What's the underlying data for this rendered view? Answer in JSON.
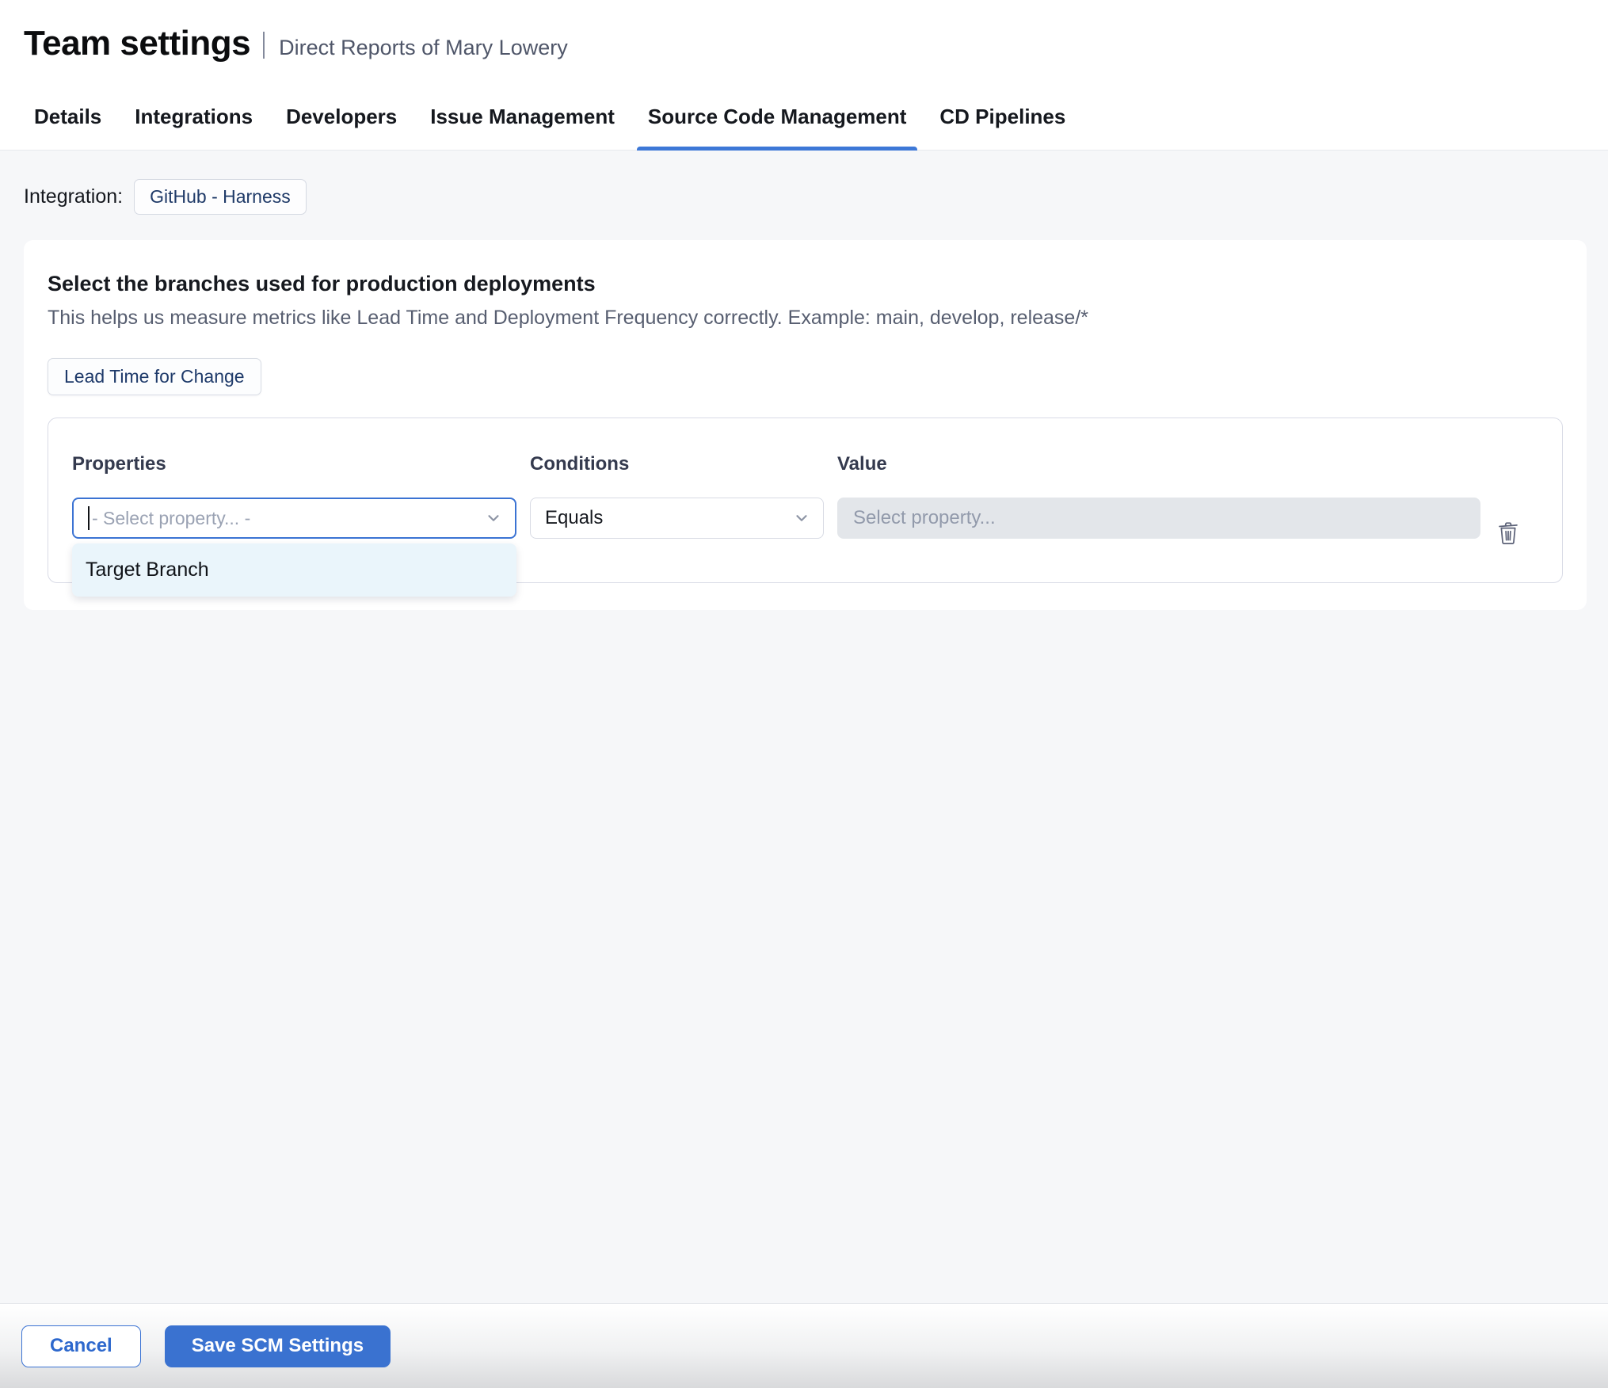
{
  "page": {
    "title": "Team settings",
    "subtitle": "Direct Reports of Mary Lowery"
  },
  "tabs": [
    {
      "label": "Details",
      "active": false
    },
    {
      "label": "Integrations",
      "active": false
    },
    {
      "label": "Developers",
      "active": false
    },
    {
      "label": "Issue Management",
      "active": false
    },
    {
      "label": "Source Code Management",
      "active": true
    },
    {
      "label": "CD Pipelines",
      "active": false
    }
  ],
  "integration": {
    "label": "Integration:",
    "chip": "GitHub - Harness"
  },
  "scm_card": {
    "heading": "Select the branches used for production deployments",
    "description": "This helps us measure metrics like Lead Time and Deployment Frequency correctly. Example: main, develop, release/*",
    "metric_tab": "Lead Time for Change",
    "filter": {
      "columns": {
        "properties": "Properties",
        "conditions": "Conditions",
        "value": "Value"
      },
      "property_placeholder": "- Select property... -",
      "condition_selected": "Equals",
      "value_placeholder": "Select property...",
      "property_options": [
        {
          "label": "Target Branch"
        }
      ]
    }
  },
  "footer": {
    "cancel": "Cancel",
    "save": "Save SCM Settings"
  },
  "icons": {
    "chevron_down": "chevron-down",
    "trash": "trash"
  },
  "colors": {
    "accent_blue": "#3b73d3",
    "save_button_blue": "#3a72d0",
    "tab_underline_blue": "#3d78d7",
    "chip_text_navy": "#1f3a68",
    "disabled_input_bg": "#e3e6ea",
    "dropdown_menu_bg": "#eaf5fb",
    "content_bg": "#f6f7f9"
  }
}
